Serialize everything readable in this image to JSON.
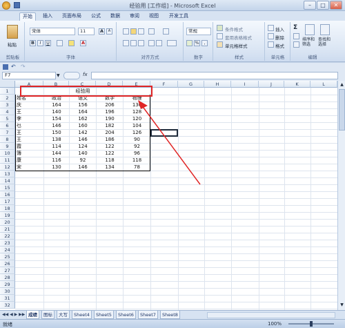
{
  "window": {
    "title": "经验用 [工作组] - Microsoft Excel",
    "min": "–",
    "max": "□",
    "close": "✕"
  },
  "tabs": [
    "开始",
    "插入",
    "页面布局",
    "公式",
    "数据",
    "审阅",
    "视图",
    "开发工具"
  ],
  "ribbon": {
    "clipboard": {
      "paste": "粘贴",
      "label": "剪贴板"
    },
    "font": {
      "name": "宋体",
      "size": "11",
      "bold": "B",
      "italic": "I",
      "underline": "U",
      "grow": "A",
      "shrink": "A",
      "color": "A",
      "label": "字体"
    },
    "alignment": {
      "label": "对齐方式"
    },
    "number": {
      "format": "常规",
      "percent": "%",
      "comma": ",",
      "label": "数字"
    },
    "styles": {
      "conditional": "条件格式",
      "table": "套用表格格式",
      "cell": "单元格样式",
      "label": "样式"
    },
    "cells": {
      "insert": "插入",
      "delete": "删除",
      "format": "格式",
      "label": "单元格"
    },
    "editing": {
      "sigma": "Σ",
      "sort": "排序和筛选",
      "find": "查找和选择",
      "label": "编辑"
    }
  },
  "formula_bar": {
    "name_box": "F7",
    "fx": "fx",
    "formula": ""
  },
  "columns": [
    "A",
    "B",
    "C",
    "D",
    "E",
    "F",
    "G",
    "H",
    "I",
    "J",
    "K",
    "L"
  ],
  "rows": [
    "1",
    "2",
    "3",
    "4",
    "5",
    "6",
    "7",
    "8",
    "9",
    "10",
    "11",
    "12",
    "13",
    "14",
    "15",
    "16",
    "17",
    "18",
    "19",
    "20",
    "21",
    "22",
    "23",
    "24",
    "25",
    "26",
    "27",
    "28",
    "29",
    "30",
    "31",
    "32"
  ],
  "table": {
    "title": "经验用",
    "headers": [
      "姓名",
      "政治",
      "语文",
      "数学",
      "物理"
    ],
    "data": [
      [
        "庆",
        "164",
        "156",
        "206",
        "130"
      ],
      [
        "王",
        "140",
        "164",
        "196",
        "128"
      ],
      [
        "李",
        "154",
        "162",
        "190",
        "120"
      ],
      [
        "乜",
        "146",
        "160",
        "182",
        "104"
      ],
      [
        "王",
        "150",
        "142",
        "204",
        "126"
      ],
      [
        "王",
        "138",
        "146",
        "186",
        "90"
      ],
      [
        "霞",
        "114",
        "124",
        "122",
        "92"
      ],
      [
        "簿",
        "144",
        "140",
        "122",
        "96"
      ],
      [
        "康",
        "116",
        "92",
        "118",
        "118"
      ],
      [
        "宋",
        "130",
        "146",
        "134",
        "78"
      ]
    ]
  },
  "annotation": {
    "color": "#e02424"
  },
  "sheet_tabs": [
    "成绩",
    "图标",
    "大写",
    "Sheet4",
    "Sheet5",
    "Sheet6",
    "Sheet7",
    "Sheet8"
  ],
  "status": {
    "ready": "就绪",
    "zoom": "100%"
  }
}
